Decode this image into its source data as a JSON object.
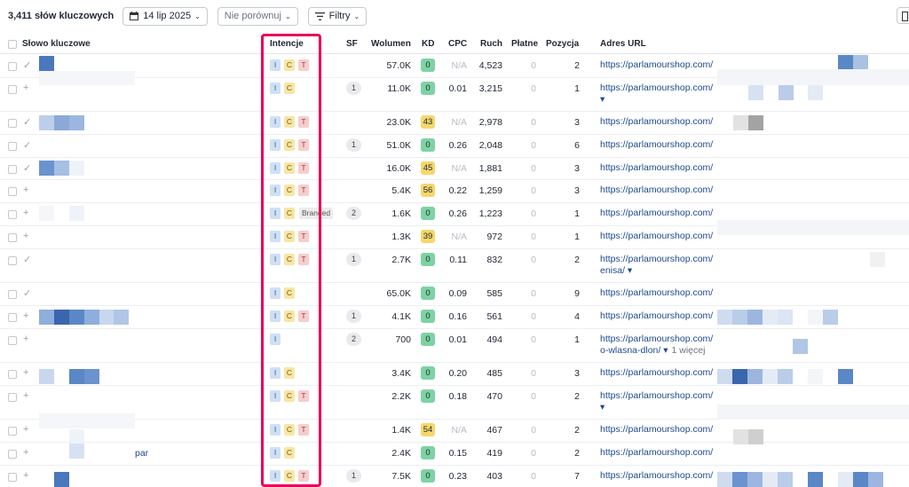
{
  "toolbar": {
    "keyword_count": "3,411 słów kluczowych",
    "date": "14 lip 2025",
    "compare": "Nie porównuj",
    "filters": "Filtry"
  },
  "headers": {
    "keyword": "Słowo kluczowe",
    "intent": "Intencje",
    "sf": "SF",
    "volume": "Wolumen",
    "kd": "KD",
    "cpc": "CPC",
    "traffic": "Ruch",
    "paid": "Płatne",
    "position": "Pozycja",
    "url": "Adres URL"
  },
  "colors": {
    "highlight": "#e8005a",
    "kd_green": "#7dd3a3",
    "kd_yellow": "#f5d76b",
    "link": "#1d4a8f"
  },
  "rows": [
    {
      "mark": "✓",
      "intents": [
        "I",
        "C",
        "T"
      ],
      "sf": "",
      "volume": "57.0K",
      "kd": "0",
      "kd_color": "green",
      "cpc": "N/A",
      "traffic": "4,523",
      "paid": "0",
      "position": "2",
      "url": "https://parlamourshop.com/",
      "url2": "",
      "more": "",
      "kw": ""
    },
    {
      "mark": "+",
      "intents": [
        "I",
        "C"
      ],
      "sf": "1",
      "volume": "11.0K",
      "kd": "0",
      "kd_color": "green",
      "cpc": "0.01",
      "traffic": "3,215",
      "paid": "0",
      "position": "1",
      "url": "https://parlamourshop.com/",
      "url2": "▾",
      "more": "",
      "kw": ""
    },
    {
      "mark": "✓",
      "intents": [
        "I",
        "C",
        "T"
      ],
      "sf": "",
      "volume": "23.0K",
      "kd": "43",
      "kd_color": "yellow",
      "cpc": "N/A",
      "traffic": "2,978",
      "paid": "0",
      "position": "3",
      "url": "https://parlamourshop.com/",
      "url2": "",
      "more": "",
      "kw": ""
    },
    {
      "mark": "✓",
      "intents": [
        "I",
        "C",
        "T"
      ],
      "sf": "1",
      "volume": "51.0K",
      "kd": "0",
      "kd_color": "green",
      "cpc": "0.26",
      "traffic": "2,048",
      "paid": "0",
      "position": "6",
      "url": "https://parlamourshop.com/",
      "url2": "",
      "more": "",
      "kw": ""
    },
    {
      "mark": "✓",
      "intents": [
        "I",
        "C",
        "T"
      ],
      "sf": "",
      "volume": "16.0K",
      "kd": "45",
      "kd_color": "yellow",
      "cpc": "N/A",
      "traffic": "1,881",
      "paid": "0",
      "position": "3",
      "url": "https://parlamourshop.com/",
      "url2": "",
      "more": "",
      "kw": ""
    },
    {
      "mark": "+",
      "intents": [
        "I",
        "C",
        "T"
      ],
      "sf": "",
      "volume": "5.4K",
      "kd": "56",
      "kd_color": "yellow",
      "cpc": "0.22",
      "traffic": "1,259",
      "paid": "0",
      "position": "3",
      "url": "https://parlamourshop.com/",
      "url2": "",
      "more": "",
      "kw": ""
    },
    {
      "mark": "+",
      "intents": [
        "I",
        "C"
      ],
      "branded": "Branded",
      "sf": "2",
      "volume": "1.6K",
      "kd": "0",
      "kd_color": "green",
      "cpc": "0.26",
      "traffic": "1,223",
      "paid": "0",
      "position": "1",
      "url": "https://parlamourshop.com/",
      "url2": "",
      "more": "",
      "kw": ""
    },
    {
      "mark": "+",
      "intents": [
        "I",
        "C",
        "T"
      ],
      "sf": "",
      "volume": "1.3K",
      "kd": "39",
      "kd_color": "yellow",
      "cpc": "N/A",
      "traffic": "972",
      "paid": "0",
      "position": "1",
      "url": "https://parlamourshop.com/",
      "url2": "",
      "more": "",
      "kw": ""
    },
    {
      "mark": "✓",
      "intents": [
        "I",
        "C",
        "T"
      ],
      "sf": "1",
      "volume": "2.7K",
      "kd": "0",
      "kd_color": "green",
      "cpc": "0.11",
      "traffic": "832",
      "paid": "0",
      "position": "2",
      "url": "https://parlamourshop.com/",
      "url2": "enisa/ ▾",
      "more": "",
      "kw": ""
    },
    {
      "mark": "✓",
      "intents": [
        "I",
        "C"
      ],
      "sf": "",
      "volume": "65.0K",
      "kd": "0",
      "kd_color": "green",
      "cpc": "0.09",
      "traffic": "585",
      "paid": "0",
      "position": "9",
      "url": "https://parlamourshop.com/",
      "url2": "",
      "more": "",
      "kw": ""
    },
    {
      "mark": "+",
      "intents": [
        "I",
        "C",
        "T"
      ],
      "sf": "1",
      "volume": "4.1K",
      "kd": "0",
      "kd_color": "green",
      "cpc": "0.16",
      "traffic": "561",
      "paid": "0",
      "position": "4",
      "url": "https://parlamourshop.com/",
      "url2": "",
      "more": "",
      "kw": ""
    },
    {
      "mark": "+",
      "intents": [
        "I"
      ],
      "sf": "2",
      "volume": "700",
      "kd": "0",
      "kd_color": "green",
      "cpc": "0.01",
      "traffic": "494",
      "paid": "0",
      "position": "1",
      "url": "https://parlamourshop.com/",
      "url2": "o-wlasna-dlon/ ▾",
      "more": "1 więcej",
      "kw": ""
    },
    {
      "mark": "+",
      "intents": [
        "I",
        "C"
      ],
      "sf": "",
      "volume": "3.4K",
      "kd": "0",
      "kd_color": "green",
      "cpc": "0.20",
      "traffic": "485",
      "paid": "0",
      "position": "3",
      "url": "https://parlamourshop.com/",
      "url2": "",
      "more": "",
      "kw": ""
    },
    {
      "mark": "+",
      "intents": [
        "I",
        "C",
        "T"
      ],
      "sf": "",
      "volume": "2.2K",
      "kd": "0",
      "kd_color": "green",
      "cpc": "0.18",
      "traffic": "470",
      "paid": "0",
      "position": "2",
      "url": "https://parlamourshop.com/",
      "url2": "▾",
      "more": "",
      "kw": ""
    },
    {
      "mark": "+",
      "intents": [
        "I",
        "C",
        "T"
      ],
      "sf": "",
      "volume": "1.4K",
      "kd": "54",
      "kd_color": "yellow",
      "cpc": "N/A",
      "traffic": "467",
      "paid": "0",
      "position": "2",
      "url": "https://parlamourshop.com/",
      "url2": "",
      "more": "",
      "kw": ""
    },
    {
      "mark": "+",
      "intents": [
        "I",
        "C"
      ],
      "sf": "",
      "volume": "2.4K",
      "kd": "0",
      "kd_color": "green",
      "cpc": "0.15",
      "traffic": "419",
      "paid": "0",
      "position": "2",
      "url": "https://parlamourshop.com/",
      "url2": "",
      "more": "",
      "kw": "par"
    },
    {
      "mark": "+",
      "intents": [
        "I",
        "C",
        "T"
      ],
      "sf": "1",
      "volume": "7.5K",
      "kd": "0",
      "kd_color": "green",
      "cpc": "0.23",
      "traffic": "403",
      "paid": "0",
      "position": "7",
      "url": "https://parlamourshop.com/",
      "url2": "",
      "more": "",
      "kw": ""
    }
  ]
}
